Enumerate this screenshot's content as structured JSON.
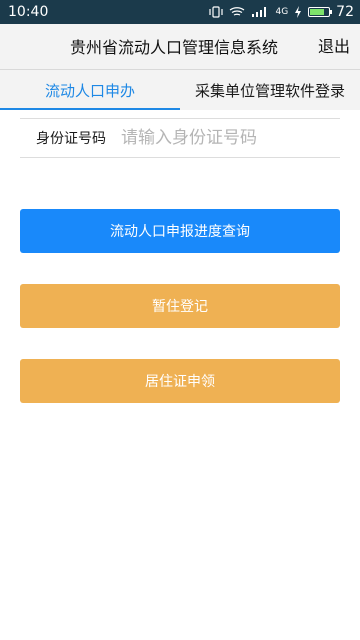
{
  "status_bar": {
    "time": "10:40",
    "network_label": "4G",
    "battery_level": "72"
  },
  "app_bar": {
    "title": "贵州省流动人口管理信息系统",
    "logout_label": "退出"
  },
  "tabs": [
    {
      "label": "流动人口申办",
      "active": true
    },
    {
      "label": "采集单位管理软件登录",
      "active": false
    }
  ],
  "id_field": {
    "label": "身份证号码",
    "placeholder": "请输入身份证号码",
    "value": ""
  },
  "buttons": {
    "query": "流动人口申报进度查询",
    "temp_registration": "暂住登记",
    "residence_permit": "居住证申领"
  },
  "colors": {
    "status_bar": "#1b3a4b",
    "accent_blue": "#1989fa",
    "tab_active": "#1e88e5",
    "accent_orange": "#efb153"
  }
}
